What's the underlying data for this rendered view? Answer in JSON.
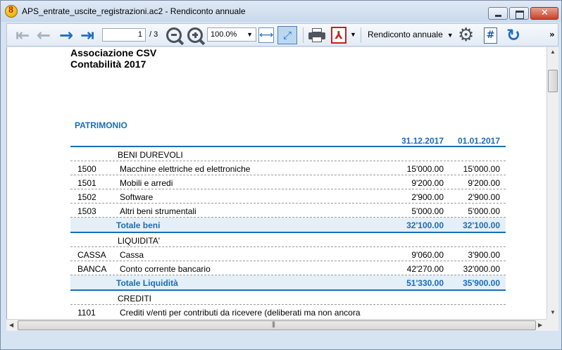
{
  "window": {
    "title": "APS_entrate_uscite_registrazioni.ac2 - Rendiconto annuale"
  },
  "toolbar": {
    "first_icon": "double-arrow-left-icon",
    "prev_icon": "arrow-left-icon",
    "next_icon": "arrow-right-icon",
    "last_icon": "double-arrow-right-icon",
    "page_value": "1",
    "page_total": "/ 3",
    "zoom_value": "100.0%",
    "report_name": "Rendiconto annuale",
    "more_label": "»"
  },
  "report": {
    "org_name": "Associazione CSV",
    "subtitle": "Contabilità 2017",
    "section_title": "PATRIMONIO",
    "col1_header": "31.12.2017",
    "col2_header": "01.01.2017",
    "rows": [
      {
        "type": "group",
        "desc": "BENI DUREVOLI"
      },
      {
        "type": "item",
        "code": "1500",
        "desc": "Macchine elettriche ed elettroniche",
        "v1": "15'000.00",
        "v2": "15'000.00"
      },
      {
        "type": "item",
        "code": "1501",
        "desc": "Mobili e arredi",
        "v1": "9'200.00",
        "v2": "9'200.00"
      },
      {
        "type": "item",
        "code": "1502",
        "desc": "Software",
        "v1": "2'900.00",
        "v2": "2'900.00"
      },
      {
        "type": "item",
        "code": "1503",
        "desc": "Altri beni strumentali",
        "v1": "5'000.00",
        "v2": "5'000.00"
      },
      {
        "type": "total",
        "desc": "Totale beni",
        "v1": "32'100.00",
        "v2": "32'100.00"
      },
      {
        "type": "group",
        "desc": "LIQUIDITA'"
      },
      {
        "type": "item",
        "code": "CASSA",
        "desc": "Cassa",
        "v1": "9'060.00",
        "v2": "3'900.00"
      },
      {
        "type": "item",
        "code": "BANCA",
        "desc": "Conto corrente bancario",
        "v1": "42'270.00",
        "v2": "32'000.00"
      },
      {
        "type": "total",
        "desc": "Totale Liquidità",
        "v1": "51'330.00",
        "v2": "35'900.00"
      },
      {
        "type": "group",
        "desc": "CREDITI"
      },
      {
        "type": "item",
        "code": "1101",
        "desc": "Crediti v/enti per contributi da ricevere (deliberati ma non ancora",
        "v1": "",
        "v2": ""
      }
    ]
  }
}
